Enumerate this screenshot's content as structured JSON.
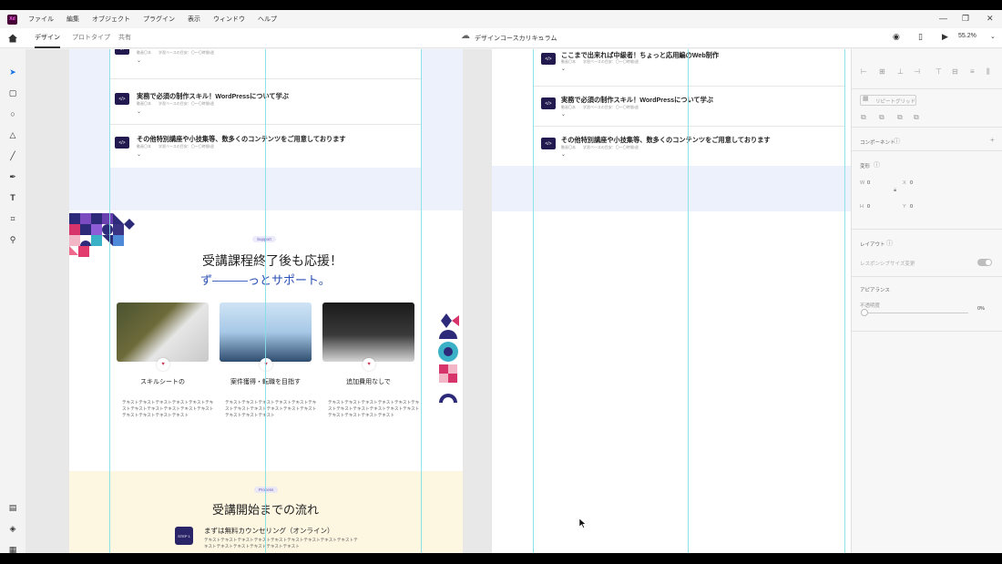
{
  "app": {
    "logo_text": "Xd"
  },
  "menu": [
    "ファイル",
    "編集",
    "オブジェクト",
    "プラグイン",
    "表示",
    "ウィンドウ",
    "ヘルプ"
  ],
  "tabs": [
    {
      "label": "デザイン",
      "active": true
    },
    {
      "label": "プロトタイプ",
      "active": false
    },
    {
      "label": "共有",
      "active": false
    }
  ],
  "document": {
    "title": "デザインコースカリキュラム",
    "zoom": "55.2%"
  },
  "list_left": [
    {
      "title": "実務で必須の制作スキル！WordPressについて学ぶ",
      "meta": "動画〇本　　学習ベースの目安：〇〜〇時間/週"
    },
    {
      "title": "その他特別講座や小技集等、数多くのコンテンツをご用意しております",
      "meta": "動画〇本　　学習ベースの目安：〇〜〇時間/週"
    }
  ],
  "list_right": [
    {
      "title": "ここまで出来れば中級者！ちょっと応用編のWeb制作",
      "meta": "動画〇本　　学習ベースの目安：〇〜〇時間/週"
    },
    {
      "title": "実務で必須の制作スキル！WordPressについて学ぶ",
      "meta": "動画〇本　　学習ベースの目安：〇〜〇時間/週"
    },
    {
      "title": "その他特別講座や小技集等、数多くのコンテンツをご用意しております",
      "meta": "動画〇本　　学習ベースの目安：〇〜〇時間/週"
    }
  ],
  "list_top_meta": "動画〇本　　学習ベースの目安：〇〜〇時間/週",
  "row_icon_text": "</>",
  "support": {
    "badge": "Support",
    "heading": "受講課程終了後も応援！",
    "subheading": "ず―――っとサポート。",
    "cards": [
      {
        "title": "スキルシートの",
        "text": "テキストテキストテキストテキストテキストテキストテキストテキストテキストテキストテキストテキストテキストテキストテキスト"
      },
      {
        "title": "案件獲得・転職を目指す",
        "text": "テキストテキストテキストテキストテキストテキストテキストテキストテキストテキストテキストテキストテキストテキスト"
      },
      {
        "title": "追加費用なしで",
        "text": "テキストテキストテキストテキストテキストテキストテキストテキストテキストテキストテキストテキストテキストテキストテキスト"
      }
    ]
  },
  "process": {
    "badge": "Process",
    "heading": "受講開始までの流れ",
    "step_label": "STEP 1",
    "step_title": "まずは無料カウンセリング（オンライン）",
    "step_text": "テキストテキストテキストテキストテキストテキストテキストテキストテキストテキストテキストテキストテキストテキストテキスト"
  },
  "panel": {
    "repeat_grid": "リピートグリッド",
    "component": "コンポーネント",
    "transform": "変形",
    "w_label": "W",
    "w_value": "0",
    "x_label": "X",
    "x_value": "0",
    "h_label": "H",
    "h_value": "0",
    "y_label": "Y",
    "y_value": "0",
    "layout": "レイアウト",
    "responsive": "レスポンシブサイズ変更",
    "appearance": "アピアランス",
    "opacity_label": "不透明度",
    "opacity_value": "0%"
  },
  "colors": {
    "accent_navy": "#221a4e",
    "guide": "#7fe0e6",
    "brand_blue": "#2a4fb5",
    "process_bg": "#fdf6e1",
    "band_bg": "#edf1fb"
  }
}
